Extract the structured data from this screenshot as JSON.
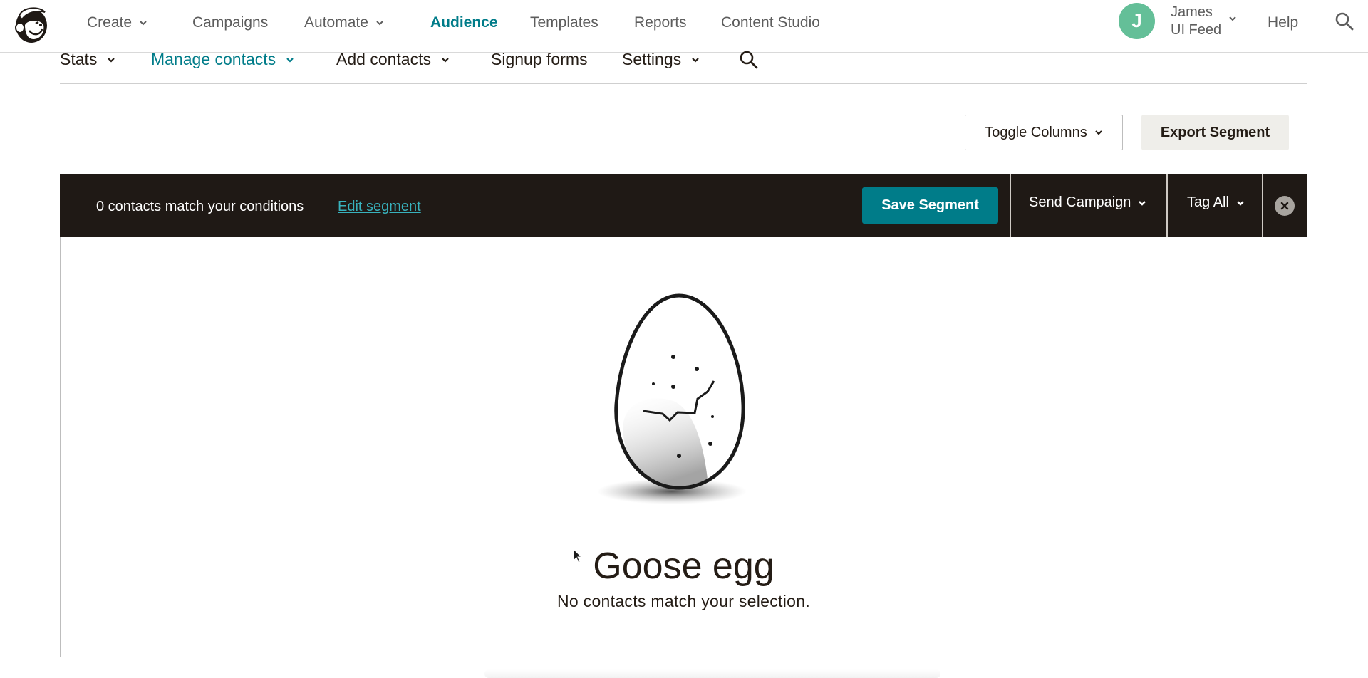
{
  "header": {
    "logo": "mailchimp-freddie-logo",
    "nav": [
      {
        "label": "Create",
        "has_dropdown": true,
        "active": false
      },
      {
        "label": "Campaigns",
        "has_dropdown": false,
        "active": false
      },
      {
        "label": "Automate",
        "has_dropdown": true,
        "active": false
      },
      {
        "label": "Audience",
        "has_dropdown": false,
        "active": true
      },
      {
        "label": "Templates",
        "has_dropdown": false,
        "active": false
      },
      {
        "label": "Reports",
        "has_dropdown": false,
        "active": false
      },
      {
        "label": "Content Studio",
        "has_dropdown": false,
        "active": false
      }
    ],
    "user": {
      "initial": "J",
      "name": "James",
      "account": "UI Feed",
      "avatar_color": "#64bf98"
    },
    "help_label": "Help",
    "search_icon": "search-icon"
  },
  "subnav": {
    "items": [
      {
        "label": "Stats",
        "has_dropdown": true,
        "active": false
      },
      {
        "label": "Manage contacts",
        "has_dropdown": true,
        "active": true
      },
      {
        "label": "Add contacts",
        "has_dropdown": true,
        "active": false
      },
      {
        "label": "Signup forms",
        "has_dropdown": false,
        "active": false
      },
      {
        "label": "Settings",
        "has_dropdown": true,
        "active": false
      }
    ],
    "search_icon": "search-icon"
  },
  "actions": {
    "toggle_columns_label": "Toggle Columns",
    "export_segment_label": "Export Segment"
  },
  "segment_bar": {
    "count_text": "0 contacts match your conditions",
    "edit_link": "Edit segment",
    "save_label": "Save Segment",
    "send_campaign_label": "Send Campaign",
    "tag_all_label": "Tag All",
    "close_icon": "close-circle-icon"
  },
  "empty_state": {
    "illustration": "cracked-egg-illustration",
    "title": "Goose egg",
    "message": "No contacts match your selection."
  },
  "colors": {
    "brand_teal": "#007c89",
    "link_teal": "#38b2bd",
    "dark_bar": "#1f1915",
    "export_bg": "#efeeea"
  }
}
